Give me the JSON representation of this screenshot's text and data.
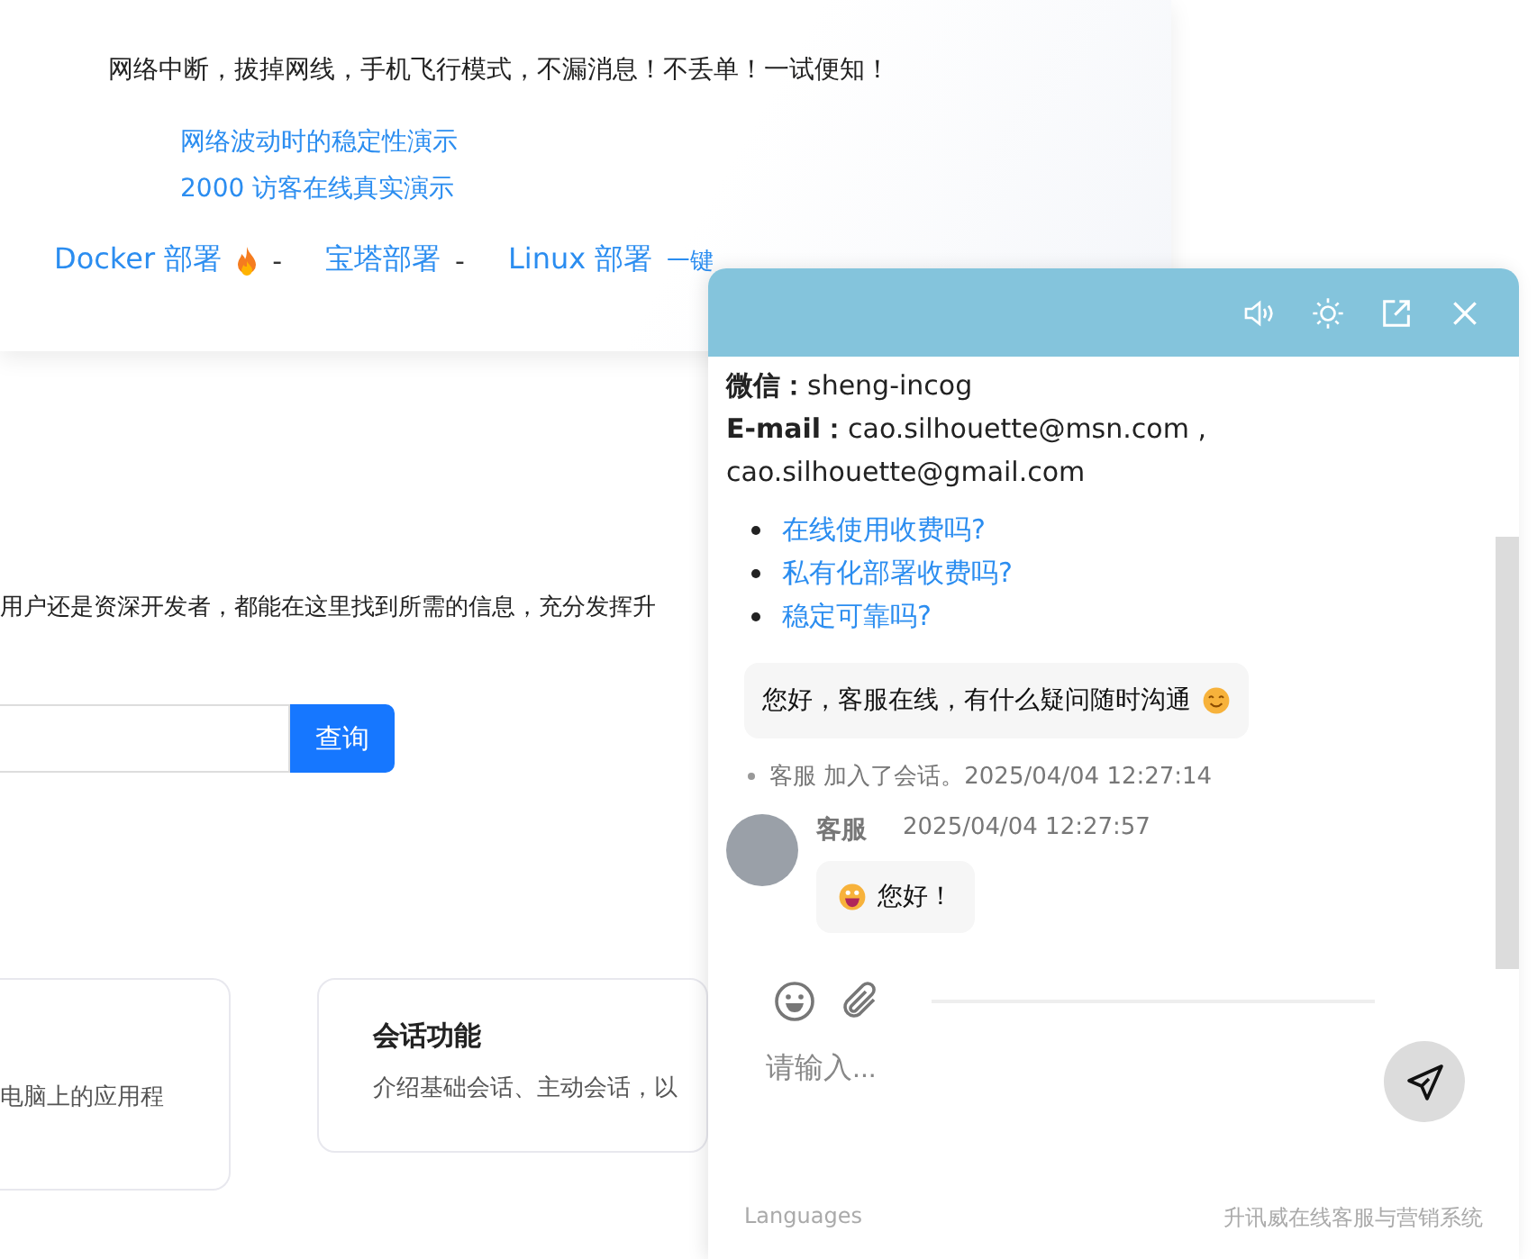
{
  "page": {
    "tagline": "网络中断，拔掉网线，手机飞行模式，不漏消息！不丢单！一试便知！",
    "demo_links": [
      "网络波动时的稳定性演示",
      "2000 访客在线真实演示"
    ],
    "deploy_links": [
      {
        "label": "Docker 部署",
        "hot": true,
        "separator": "-"
      },
      {
        "label": "宝塔部署",
        "hot": false,
        "separator": "-"
      },
      {
        "label": "Linux 部署",
        "hot": false,
        "note": "一键"
      }
    ],
    "intro": "用户还是资深开发者，都能在这里找到所需的信息，充分发挥升",
    "search": {
      "button": "查询"
    },
    "cards": [
      {
        "desc": "电脑上的应用程"
      },
      {
        "title": "会话功能",
        "desc": "介绍基础会话、主动会话，以"
      }
    ]
  },
  "chat": {
    "contact": [
      {
        "label": "微信：",
        "value": "sheng-incog"
      },
      {
        "label": "E-mail：",
        "value": "cao.silhouette@msn.com ,"
      }
    ],
    "contact_extra": "cao.silhouette@gmail.com",
    "faq": [
      "在线使用收费吗?",
      "私有化部署收费吗?",
      "稳定可靠吗?"
    ],
    "messages": [
      {
        "kind": "bubble",
        "text": "您好，客服在线，有什么疑问随时沟通"
      },
      {
        "kind": "system",
        "text": "客服 加入了会话。2025/04/04 12:27:14"
      },
      {
        "kind": "agent",
        "name": "客服",
        "time": "2025/04/04 12:27:57",
        "text": "您好！"
      }
    ],
    "input": {
      "placeholder": "请输入..."
    },
    "footer": {
      "left": "Languages",
      "right": "升讯威在线客服与营销系统"
    }
  }
}
